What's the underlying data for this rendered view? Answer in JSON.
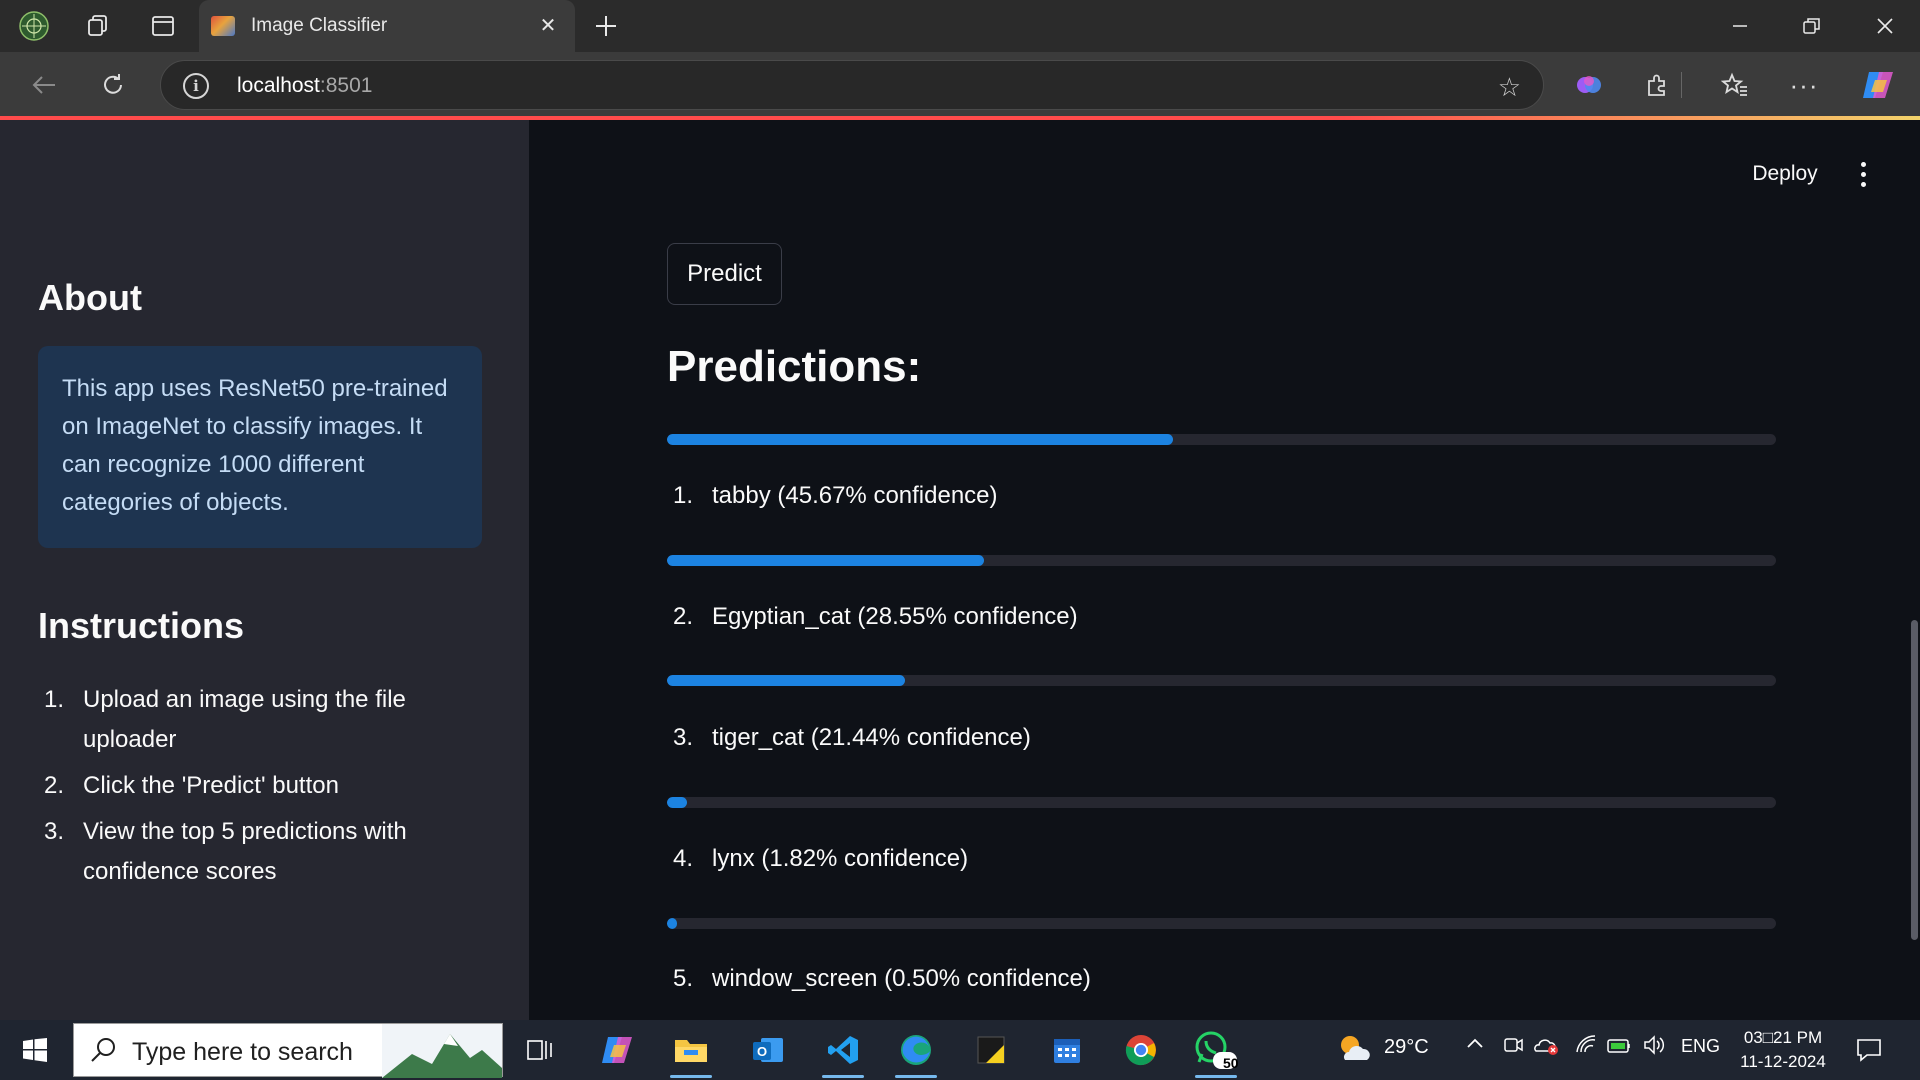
{
  "browser": {
    "tab_title": "Image Classifier",
    "url_host": "localhost",
    "url_port": ":8501"
  },
  "header": {
    "deploy_label": "Deploy"
  },
  "sidebar": {
    "about_heading": "About",
    "about_text": "This app uses ResNet50 pre-trained on ImageNet to classify images. It can recognize 1000 different categories of objects.",
    "instructions_heading": "Instructions",
    "instructions": [
      {
        "num": "1.",
        "text": "Upload an image using the file uploader"
      },
      {
        "num": "2.",
        "text": "Click the 'Predict' button"
      },
      {
        "num": "3.",
        "text": "View the top 5 predictions with confidence scores"
      }
    ]
  },
  "main": {
    "predict_label": "Predict",
    "predictions_heading": "Predictions:",
    "predictions": [
      {
        "num": "1.",
        "text": "tabby (45.67% confidence)",
        "progress": 0.4567
      },
      {
        "num": "2.",
        "text": "Egyptian_cat (28.55% confidence)",
        "progress": 0.2855
      },
      {
        "num": "3.",
        "text": "tiger_cat (21.44% confidence)",
        "progress": 0.2144
      },
      {
        "num": "4.",
        "text": "lynx (1.82% confidence)",
        "progress": 0.0182
      },
      {
        "num": "5.",
        "text": "window_screen (0.50% confidence)",
        "progress": 0.005
      }
    ],
    "progress_color": "#1c83e1"
  },
  "taskbar": {
    "search_placeholder": "Type here to search",
    "weather_temp": "29°C",
    "language": "ENG",
    "time": "03□21 PM",
    "date": "11-12-2024",
    "whatsapp_badge": "50"
  }
}
